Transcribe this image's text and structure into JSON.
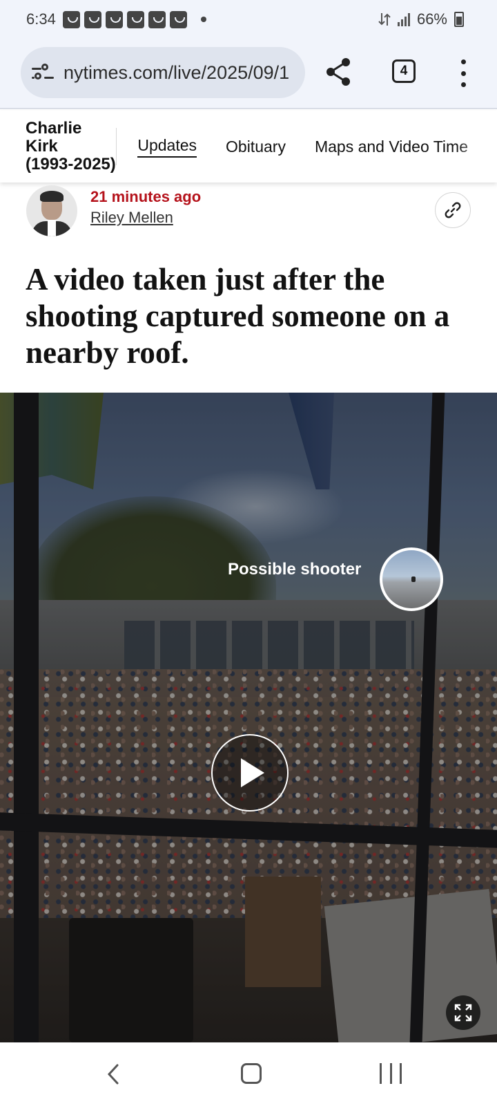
{
  "status_bar": {
    "time": "6:34",
    "battery_percent": "66%",
    "notification_count": 6,
    "icons": [
      "notification-icon",
      "data-transfer-icon",
      "signal-icon",
      "battery-icon"
    ]
  },
  "browser": {
    "url": "nytimes.com/live/2025/09/1",
    "tab_count": "4",
    "icons": [
      "site-settings-icon",
      "share-icon",
      "tabs-icon",
      "more-options-icon"
    ]
  },
  "section_nav": {
    "title_line1": "Charlie Kirk",
    "title_line2": "(1993-2025)",
    "links": [
      {
        "label": "Updates",
        "active": true
      },
      {
        "label": "Obituary",
        "active": false
      },
      {
        "label": "Maps and Video Time",
        "active": false
      }
    ]
  },
  "byline": {
    "timestamp": "21 minutes ago",
    "author": "Riley Mellen",
    "timestamp_color": "#b5121b"
  },
  "headline": "A video taken just after the shooting captured someone on a nearby roof.",
  "video": {
    "annotation_label": "Possible shooter",
    "icons": [
      "play-icon",
      "fullscreen-icon"
    ]
  },
  "system_nav": {
    "icons": [
      "back-icon",
      "home-icon",
      "recent-apps-icon"
    ]
  }
}
